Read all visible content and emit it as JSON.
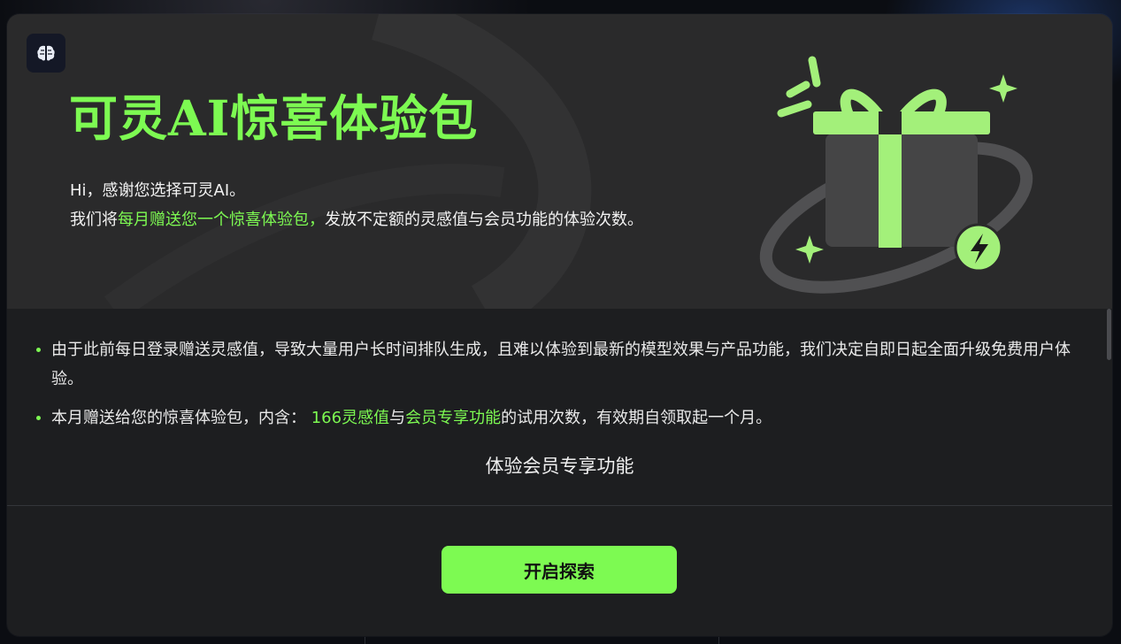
{
  "hero": {
    "title": "可灵AI惊喜体验包",
    "greeting": "Hi，感谢您选择可灵AI。",
    "intro_prefix": "我们将",
    "intro_highlight": "每月赠送您一个惊喜体验包，",
    "intro_suffix": "发放不定额的灵感值与会员功能的体验次数。"
  },
  "bullets": {
    "item1": "由于此前每日登录赠送灵感值，导致大量用户长时间排队生成，且难以体验到最新的模型效果与产品功能，我们决定自即日起全面升级免费用户体验。",
    "item2_prefix": "本月赠送给您的惊喜体验包，内含： ",
    "item2_credits": "166灵感值",
    "item2_and": "与",
    "item2_member": "会员专享功能",
    "item2_suffix": "的试用次数，有效期自领取起一个月。"
  },
  "feature_link": "体验会员专享功能",
  "cta_label": "开启探索",
  "colors": {
    "accent": "#7dfa52",
    "modal_bg": "#1d1e20",
    "hero_bg": "#2a2a2b"
  },
  "icons": [
    "brain-logo-icon",
    "gift-illustration",
    "lightning-icon",
    "sparkle-icon"
  ]
}
